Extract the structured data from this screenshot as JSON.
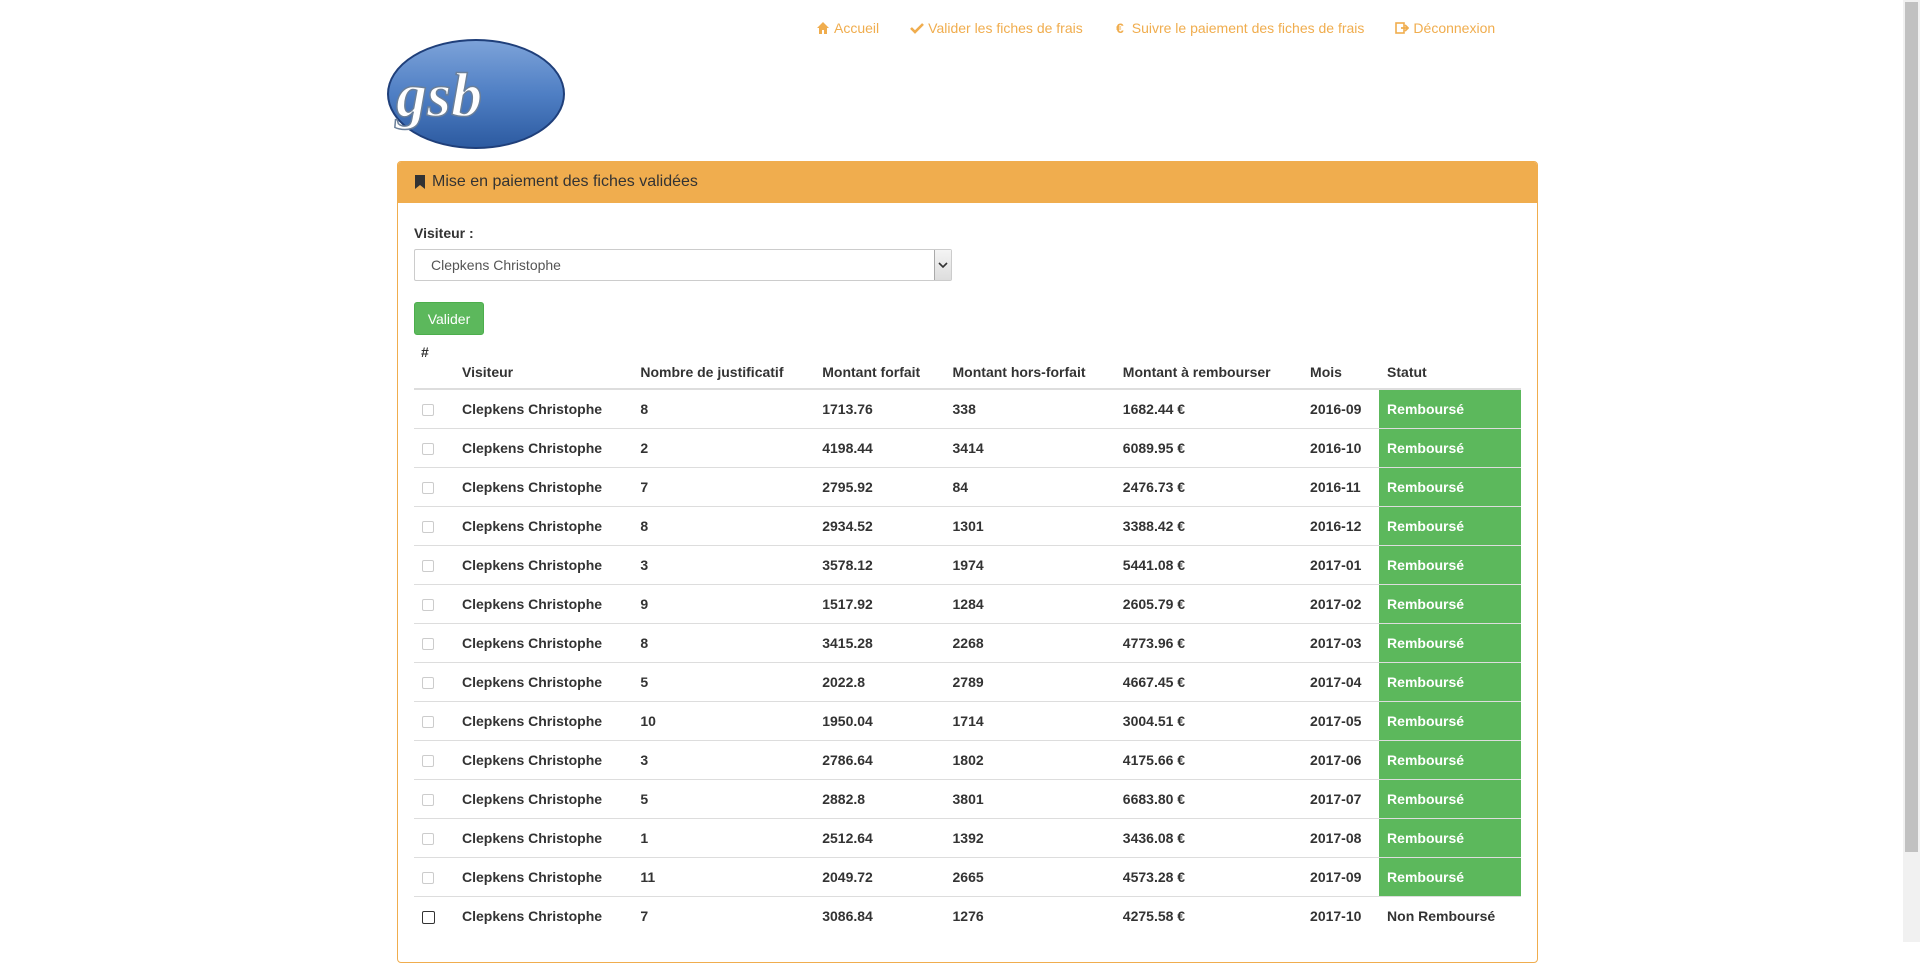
{
  "nav": {
    "items": [
      {
        "label": "Accueil",
        "icon": "home-icon"
      },
      {
        "label": "Valider les fiches de frais",
        "icon": "check-icon"
      },
      {
        "label": "Suivre le paiement des fiches de frais",
        "icon": "euro-icon"
      },
      {
        "label": "Déconnexion",
        "icon": "logout-icon"
      }
    ]
  },
  "logo": {
    "text": "gsb"
  },
  "panel": {
    "title": "Mise en paiement des fiches validées"
  },
  "form": {
    "visitor_label": "Visiteur :",
    "visitor_selected": "Clepkens Christophe",
    "submit_label": "Valider"
  },
  "table": {
    "headers": [
      "#",
      "Visiteur",
      "Nombre de justificatif",
      "Montant forfait",
      "Montant hors-forfait",
      "Montant à rembourser",
      "Mois",
      "Statut"
    ],
    "rows": [
      {
        "visiteur": "Clepkens Christophe",
        "nb": "8",
        "forfait": "1713.76",
        "hors": "338",
        "rembourser": "1682.44 €",
        "mois": "2016-09",
        "statut": "Remboursé"
      },
      {
        "visiteur": "Clepkens Christophe",
        "nb": "2",
        "forfait": "4198.44",
        "hors": "3414",
        "rembourser": "6089.95 €",
        "mois": "2016-10",
        "statut": "Remboursé"
      },
      {
        "visiteur": "Clepkens Christophe",
        "nb": "7",
        "forfait": "2795.92",
        "hors": "84",
        "rembourser": "2476.73 €",
        "mois": "2016-11",
        "statut": "Remboursé"
      },
      {
        "visiteur": "Clepkens Christophe",
        "nb": "8",
        "forfait": "2934.52",
        "hors": "1301",
        "rembourser": "3388.42 €",
        "mois": "2016-12",
        "statut": "Remboursé"
      },
      {
        "visiteur": "Clepkens Christophe",
        "nb": "3",
        "forfait": "3578.12",
        "hors": "1974",
        "rembourser": "5441.08 €",
        "mois": "2017-01",
        "statut": "Remboursé"
      },
      {
        "visiteur": "Clepkens Christophe",
        "nb": "9",
        "forfait": "1517.92",
        "hors": "1284",
        "rembourser": "2605.79 €",
        "mois": "2017-02",
        "statut": "Remboursé"
      },
      {
        "visiteur": "Clepkens Christophe",
        "nb": "8",
        "forfait": "3415.28",
        "hors": "2268",
        "rembourser": "4773.96 €",
        "mois": "2017-03",
        "statut": "Remboursé"
      },
      {
        "visiteur": "Clepkens Christophe",
        "nb": "5",
        "forfait": "2022.8",
        "hors": "2789",
        "rembourser": "4667.45 €",
        "mois": "2017-04",
        "statut": "Remboursé"
      },
      {
        "visiteur": "Clepkens Christophe",
        "nb": "10",
        "forfait": "1950.04",
        "hors": "1714",
        "rembourser": "3004.51 €",
        "mois": "2017-05",
        "statut": "Remboursé"
      },
      {
        "visiteur": "Clepkens Christophe",
        "nb": "3",
        "forfait": "2786.64",
        "hors": "1802",
        "rembourser": "4175.66 €",
        "mois": "2017-06",
        "statut": "Remboursé"
      },
      {
        "visiteur": "Clepkens Christophe",
        "nb": "5",
        "forfait": "2882.8",
        "hors": "3801",
        "rembourser": "6683.80 €",
        "mois": "2017-07",
        "statut": "Remboursé"
      },
      {
        "visiteur": "Clepkens Christophe",
        "nb": "1",
        "forfait": "2512.64",
        "hors": "1392",
        "rembourser": "3436.08 €",
        "mois": "2017-08",
        "statut": "Remboursé"
      },
      {
        "visiteur": "Clepkens Christophe",
        "nb": "11",
        "forfait": "2049.72",
        "hors": "2665",
        "rembourser": "4573.28 €",
        "mois": "2017-09",
        "statut": "Remboursé"
      },
      {
        "visiteur": "Clepkens Christophe",
        "nb": "7",
        "forfait": "3086.84",
        "hors": "1276",
        "rembourser": "4275.58 €",
        "mois": "2017-10",
        "statut": "Non Remboursé"
      }
    ]
  },
  "colors": {
    "accent": "#f0ad4e",
    "success": "#5cb85c"
  }
}
